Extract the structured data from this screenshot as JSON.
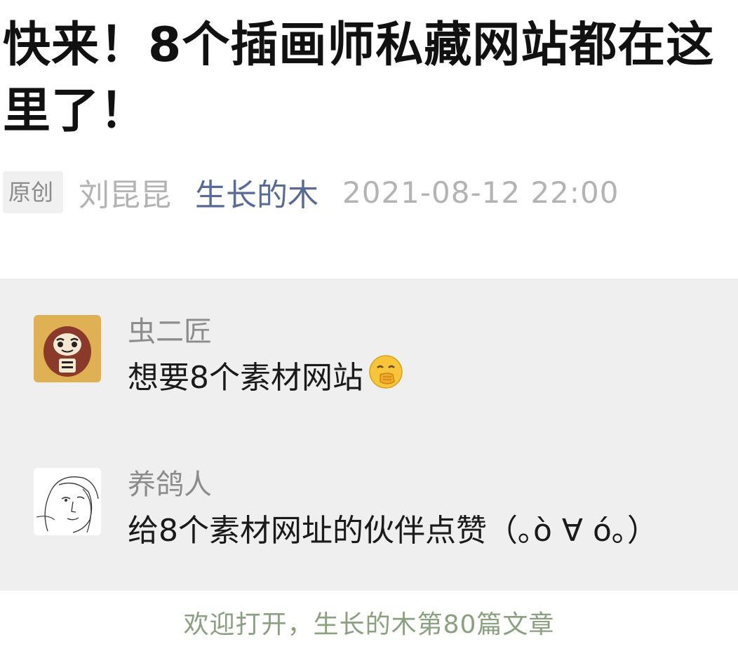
{
  "article": {
    "title": "快来！8个插画师私藏网站都在这里了！",
    "badge": "原创",
    "author": "刘昆昆",
    "account": "生长的木",
    "date": "2021-08-12 22:00"
  },
  "comments": [
    {
      "nickname": "虫二匠",
      "text": "想要8个素材网站",
      "emoji": "covering-mouth-emoji",
      "avatar": "daruma-avatar"
    },
    {
      "nickname": "养鸽人",
      "text": "给8个素材网址的伙伴点赞（｡ò ∀ ó｡）",
      "avatar": "line-drawing-face-avatar"
    }
  ],
  "footer": {
    "text": "欢迎打开，生长的木第80篇文章"
  },
  "colors": {
    "account_link": "#576b95",
    "comment_bg": "#efefef",
    "footer_text": "#8aa07f",
    "avatar1_bg": "#e0b055"
  }
}
